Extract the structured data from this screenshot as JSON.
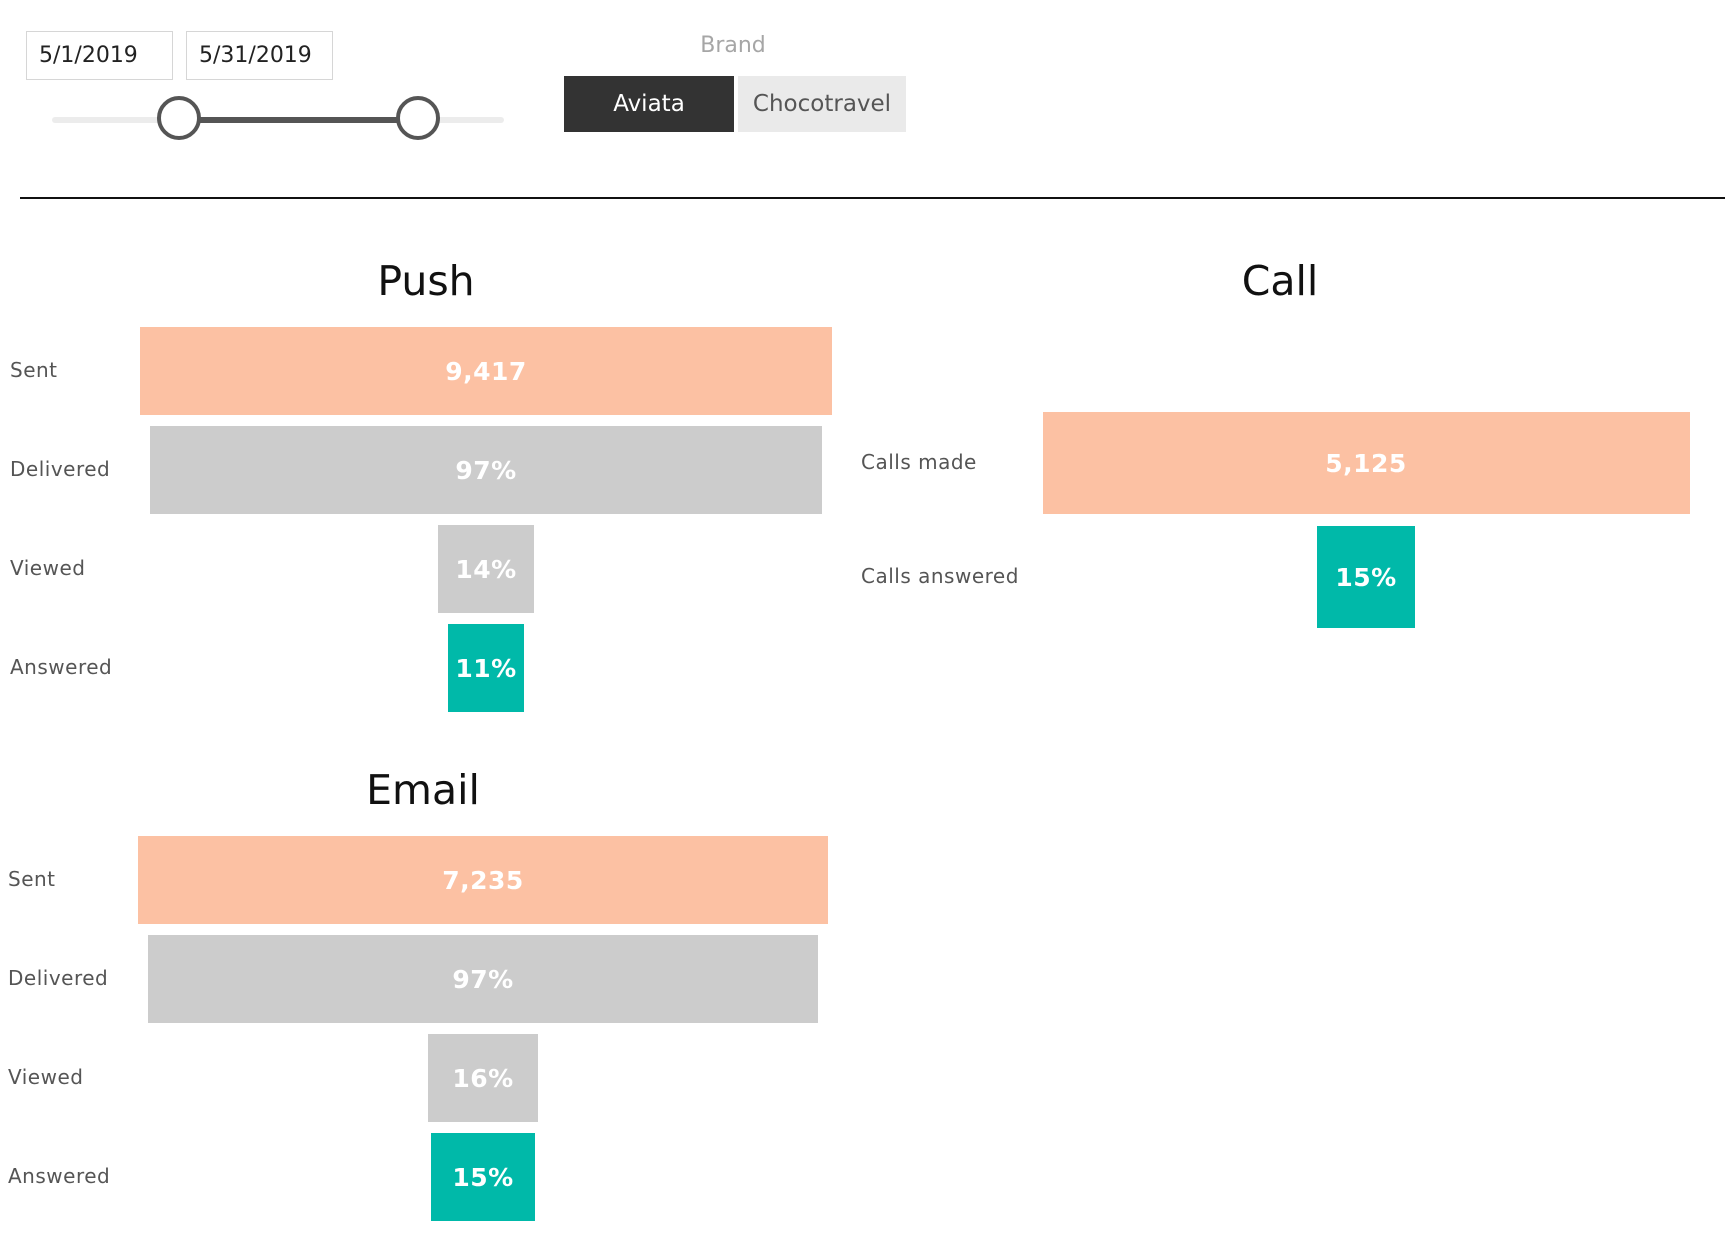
{
  "filters": {
    "date_start": "5/1/2019",
    "date_end": "5/31/2019",
    "slider": {
      "range_start": 0.28,
      "range_end": 0.81
    },
    "brand": {
      "label": "Brand",
      "options": [
        "Aviata",
        "Chocotravel"
      ],
      "selected": "Aviata"
    }
  },
  "colors": {
    "sent": "#fcc1a3",
    "mid": "#cccccc",
    "answered": "#00b9a9"
  },
  "chart_data": [
    {
      "type": "funnel",
      "title": "Push",
      "stages": [
        {
          "label": "Sent",
          "value_label": "9,417",
          "fraction": 1.0,
          "color": "sent"
        },
        {
          "label": "Delivered",
          "value_label": "97%",
          "fraction": 0.97,
          "color": "mid"
        },
        {
          "label": "Viewed",
          "value_label": "14%",
          "fraction": 0.14,
          "color": "mid"
        },
        {
          "label": "Answered",
          "value_label": "11%",
          "fraction": 0.11,
          "color": "answered"
        }
      ]
    },
    {
      "type": "funnel",
      "title": "Call",
      "stages": [
        {
          "label": "Calls made",
          "value_label": "5,125",
          "fraction": 1.0,
          "color": "sent"
        },
        {
          "label": "Calls answered",
          "value_label": "15%",
          "fraction": 0.15,
          "color": "answered"
        }
      ]
    },
    {
      "type": "funnel",
      "title": "Email",
      "stages": [
        {
          "label": "Sent",
          "value_label": "7,235",
          "fraction": 1.0,
          "color": "sent"
        },
        {
          "label": "Delivered",
          "value_label": "97%",
          "fraction": 0.97,
          "color": "mid"
        },
        {
          "label": "Viewed",
          "value_label": "16%",
          "fraction": 0.16,
          "color": "mid"
        },
        {
          "label": "Answered",
          "value_label": "15%",
          "fraction": 0.15,
          "color": "answered"
        }
      ]
    }
  ]
}
